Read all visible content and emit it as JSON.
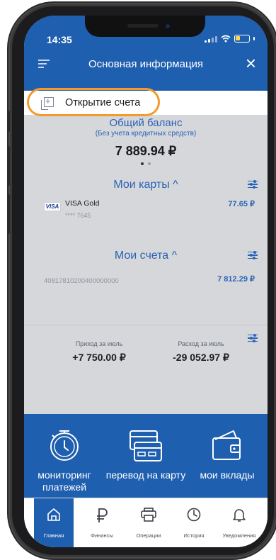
{
  "status_bar": {
    "time": "14:35"
  },
  "header": {
    "title": "Основная информация",
    "close_glyph": "×"
  },
  "open_account": {
    "label": "Открытие счета"
  },
  "balance": {
    "title": "Общий баланс",
    "subtitle": "(Без учета кредитных средств)",
    "amount": "7 889.94 ₽"
  },
  "cards": {
    "title": "Мои карты ^",
    "items": [
      {
        "brand": "VISA",
        "name": "VISA Gold",
        "mask": "**** 7645",
        "balance": "77.65 ₽"
      }
    ]
  },
  "accounts": {
    "title": "Мои счета ^",
    "items": [
      {
        "number": "40817810200400000000",
        "balance": "7 812.29 ₽"
      }
    ]
  },
  "cashflow": {
    "income_label": "Приход за июль",
    "income_value": "+7 750.00 ₽",
    "expense_label": "Расход за июль",
    "expense_value": "-29 052.97 ₽"
  },
  "actions": [
    {
      "label": "мониторинг платежей",
      "icon": "clock-icon"
    },
    {
      "label": "перевод на карту",
      "icon": "card-transfer-icon"
    },
    {
      "label": "мои вклады",
      "icon": "wallet-icon"
    }
  ],
  "tabs": [
    {
      "label": "Главная",
      "icon": "home-icon",
      "active": true
    },
    {
      "label": "Финансы",
      "icon": "ruble-icon"
    },
    {
      "label": "Операции",
      "icon": "printer-icon"
    },
    {
      "label": "История",
      "icon": "history-icon"
    },
    {
      "label": "Уведомления",
      "icon": "bell-icon"
    }
  ],
  "colors": {
    "brand_blue": "#1f5fb0",
    "accent_blue": "#2a63b6",
    "highlight_orange": "#f29b2c",
    "background_gray": "#d6d7da"
  }
}
